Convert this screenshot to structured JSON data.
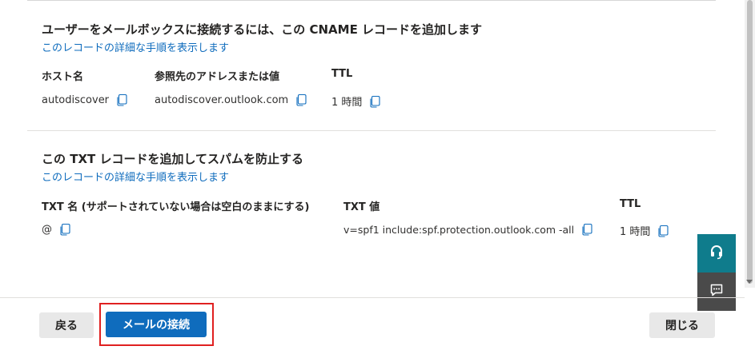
{
  "cname": {
    "title": "ユーザーをメールボックスに接続するには、この CNAME レコードを追加します",
    "link": "このレコードの詳細な手順を表示します",
    "headers": {
      "host": "ホスト名",
      "points_to": "参照先のアドレスまたは値",
      "ttl": "TTL"
    },
    "row": {
      "host": "autodiscover",
      "points_to": "autodiscover.outlook.com",
      "ttl": "1 時間"
    }
  },
  "txt": {
    "title": "この TXT レコードを追加してスパムを防止する",
    "link": "このレコードの詳細な手順を表示します",
    "headers": {
      "name": "TXT 名 (サポートされていない場合は空白のままにする)",
      "value": "TXT 値",
      "ttl": "TTL"
    },
    "row": {
      "name": "@",
      "value": "v=spf1 include:spf.protection.outlook.com -all",
      "ttl": "1 時間"
    }
  },
  "footer": {
    "back_label": "戻る",
    "connect_label": "メールの接続",
    "close_label": "閉じる"
  },
  "colors": {
    "accent": "#0f6cbd",
    "help_fab": "#0f7c8c",
    "chat_fab": "#4a4a4a",
    "highlight": "#e02020"
  },
  "icons": {
    "copy": "copy-icon",
    "help": "headset-icon",
    "chat": "chat-icon"
  }
}
